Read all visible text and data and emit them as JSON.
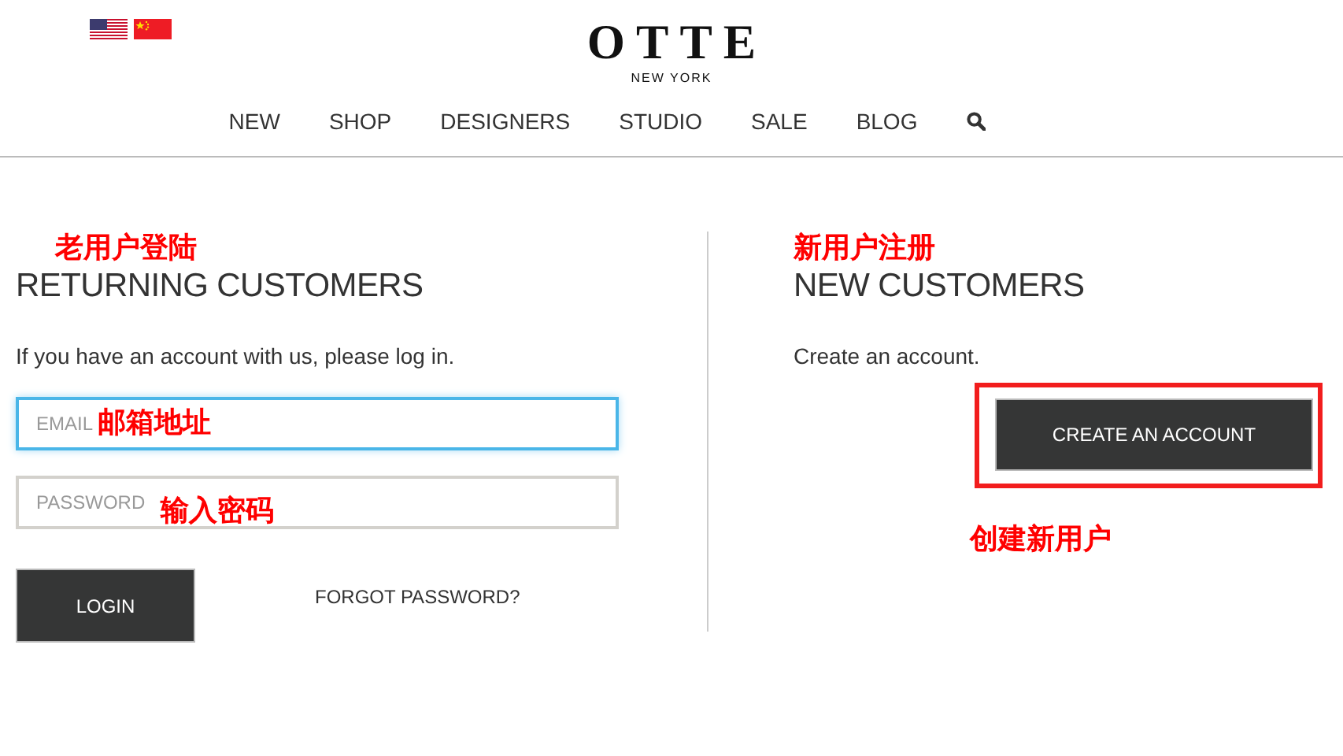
{
  "logo": {
    "name": "OTTE",
    "tagline": "NEW YORK"
  },
  "nav": [
    {
      "label": "NEW"
    },
    {
      "label": "SHOP"
    },
    {
      "label": "DESIGNERS"
    },
    {
      "label": "STUDIO"
    },
    {
      "label": "SALE"
    },
    {
      "label": "BLOG"
    }
  ],
  "returning": {
    "annotation": "老用户登陆",
    "title": "RETURNING CUSTOMERS",
    "intro": "If you have an account with us, please log in.",
    "fields": [
      {
        "placeholder": "EMAIL",
        "focused": true,
        "annotation": "邮箱地址"
      },
      {
        "placeholder": "PASSWORD",
        "focused": false,
        "annotation": "输入密码"
      }
    ],
    "login_button": "LOGIN",
    "forgot_link": "FORGOT PASSWORD?"
  },
  "new_customers": {
    "annotation": "新用户注册",
    "title": "NEW CUSTOMERS",
    "intro": "Create an account.",
    "button": "CREATE AN ACCOUNT",
    "button_annotation": "创建新用户"
  }
}
